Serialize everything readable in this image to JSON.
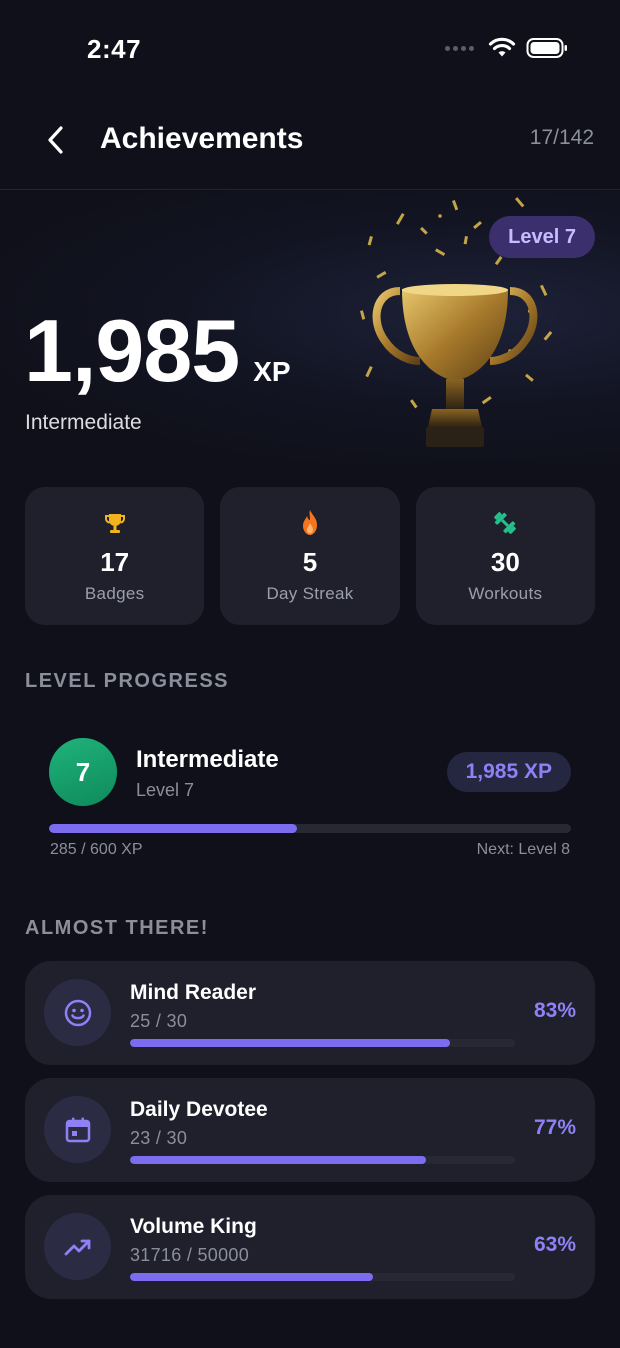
{
  "status_bar": {
    "time": "2:47"
  },
  "header": {
    "title": "Achievements",
    "badge_count": "17/142"
  },
  "hero": {
    "xp_value": "1,985",
    "xp_unit": "XP",
    "rank": "Intermediate",
    "level_badge": "Level 7"
  },
  "stats": [
    {
      "icon": "trophy-icon",
      "value": "17",
      "label": "Badges"
    },
    {
      "icon": "flame-icon",
      "value": "5",
      "label": "Day Streak"
    },
    {
      "icon": "dumbbell-icon",
      "value": "30",
      "label": "Workouts"
    }
  ],
  "level_progress": {
    "section_label": "LEVEL PROGRESS",
    "level_number": "7",
    "name": "Intermediate",
    "level_label": "Level 7",
    "xp_total": "1,985 XP",
    "progress_text": "285 / 600 XP",
    "progress_fraction": 0.475,
    "next_label": "Next: Level 8"
  },
  "almost_there": {
    "section_label": "ALMOST THERE!",
    "items": [
      {
        "icon": "smiley-icon",
        "name": "Mind Reader",
        "progress_text": "25 / 30",
        "percent": "83%",
        "fraction": 0.83
      },
      {
        "icon": "calendar-icon",
        "name": "Daily Devotee",
        "progress_text": "23 / 30",
        "percent": "77%",
        "fraction": 0.77
      },
      {
        "icon": "trending-up-icon",
        "name": "Volume King",
        "progress_text": "31716 / 50000",
        "percent": "63%",
        "fraction": 0.63
      }
    ]
  },
  "colors": {
    "accent": "#7c6cf0",
    "level_green": "#1aa36c",
    "background": "#0f1019",
    "card": "#1f202c"
  }
}
